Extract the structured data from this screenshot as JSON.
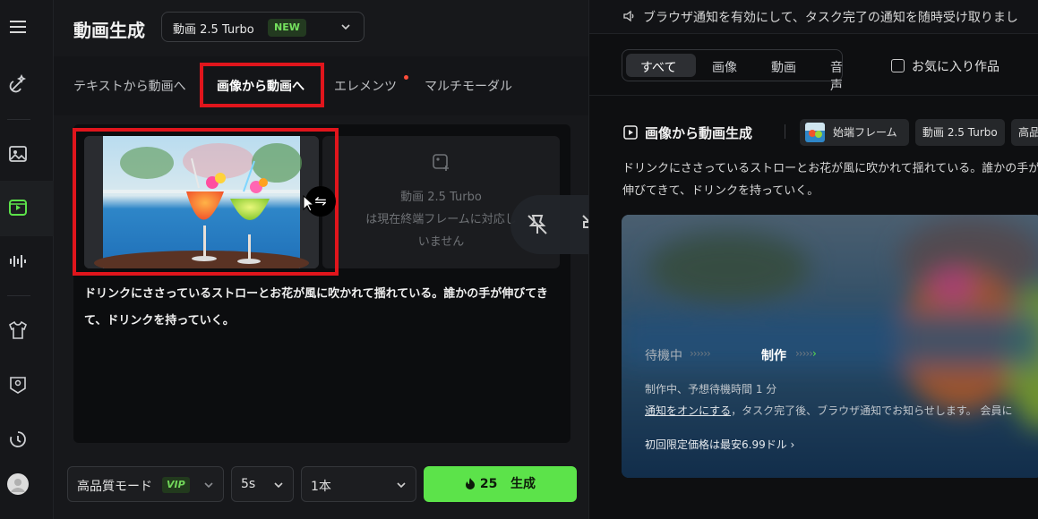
{
  "header": {
    "title": "動画生成",
    "model_name": "動画 2.5 Turbo",
    "model_badge": "NEW"
  },
  "tabs": [
    {
      "label": "テキストから動画へ"
    },
    {
      "label": "画像から動画へ"
    },
    {
      "label": "エレメンツ"
    },
    {
      "label": "マルチモーダル"
    }
  ],
  "end_frame": {
    "line1": "動画 2.5 Turbo",
    "line2": "は現在終端フレームに対応し",
    "line3": "いません"
  },
  "swap_icon": "⇋",
  "prompt_text": "ドリンクにささっているストローとお花が風に吹かれて揺れている。誰かの手が伸びてきて、ドリンクを持っていく。",
  "bottom": {
    "quality_label": "高品質モード",
    "quality_badge": "VIP",
    "duration": "5s",
    "count": "1本",
    "credits": "25",
    "generate_label": "生成"
  },
  "notice_text": "ブラウザ通知を有効にして、タスク完了の通知を随時受け取りまし",
  "filter": {
    "segments": [
      "すべて",
      "画像",
      "動画",
      "音声"
    ],
    "favorite_label": "お気に入り作品"
  },
  "task": {
    "title": "画像から動画生成",
    "chips": [
      "始端フレーム",
      "動画 2.5 Turbo",
      "高品"
    ],
    "description": "ドリンクにささっているストローとお花が風に吹かれて揺れている。誰かの手が伸びてきて、ドリンクを持っていく。",
    "status_waiting": "待機中",
    "status_making": "制作",
    "info": "制作中、予想待機時間 1 分",
    "notif_link": "通知をオンにする",
    "notif_rest": "，タスク完了後、ブラウザ通知でお知らせします。 会員に",
    "price": "初回限定価格は最安6.99ドル ›"
  },
  "colors": {
    "accent_green": "#5ce34a",
    "highlight_red": "#e0151c",
    "badge_dot": "#ff4d3b"
  }
}
